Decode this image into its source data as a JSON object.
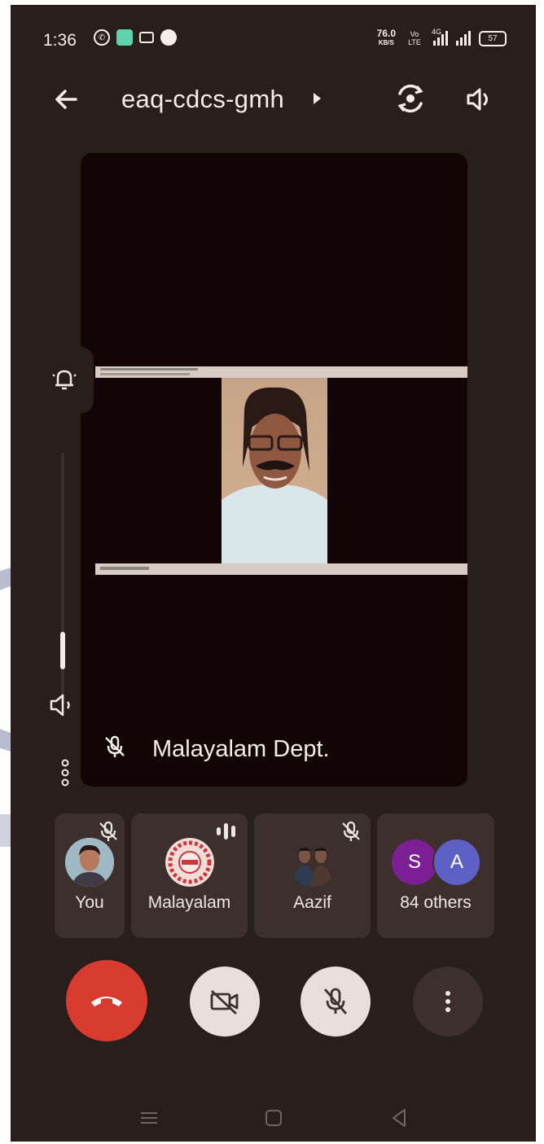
{
  "status_bar": {
    "time": "1:36",
    "net_speed_value": "76.0",
    "net_speed_unit": "KB/S",
    "volte_label": "Vo LTE",
    "network_label": "4G",
    "battery_level": "57",
    "notification_icons": [
      "whatsapp-icon",
      "app-icon",
      "video-icon",
      "jio-icon"
    ]
  },
  "header": {
    "meeting_code": "eaq-cdcs-gmh",
    "back_icon": "arrow-left-icon",
    "switch_camera_icon": "camera-switch-icon",
    "speaker_icon": "speaker-icon"
  },
  "main_tile": {
    "participant_name": "Malayalam Dept.",
    "mic_muted": true
  },
  "side_controls": {
    "volume_level": 0.15
  },
  "participants": [
    {
      "name": "You",
      "muted": true
    },
    {
      "name": "Malayalam",
      "speaking": true
    },
    {
      "name": "Aazif",
      "muted": true
    },
    {
      "name": "84 others",
      "initials": [
        "S",
        "A"
      ]
    }
  ],
  "controls": {
    "end_call": "end-call-icon",
    "camera": "camera-off-icon",
    "microphone": "mic-off-icon",
    "more": "more-vertical-icon"
  },
  "colors": {
    "background": "#2a1e1b",
    "tile": "#3d302c",
    "end_call": "#d73c2f",
    "button_light": "#e9dfda",
    "avatar_s": "#7c1f95",
    "avatar_a": "#5d61c6"
  }
}
